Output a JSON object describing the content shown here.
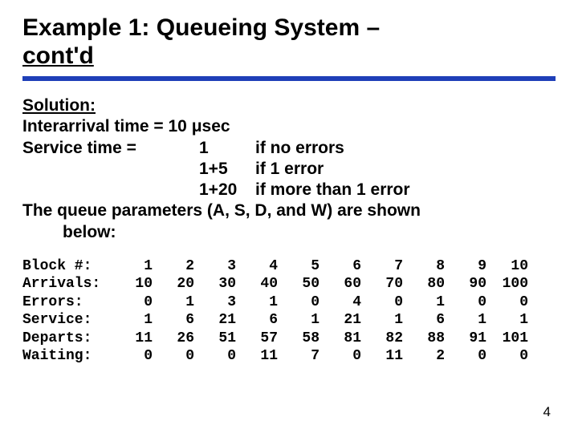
{
  "title_line1": "Example 1: Queueing System –",
  "title_line2": "cont'd",
  "solution_label": "Solution:",
  "interarrival_line": "Interarrival time = 10 μsec",
  "service_label": "Service time =",
  "service_rows": [
    {
      "value": "1",
      "cond": "if no errors"
    },
    {
      "value": "1+5",
      "cond": "if 1 error"
    },
    {
      "value": "1+20",
      "cond": "if more than 1 error"
    }
  ],
  "queue_params_line": "The queue parameters (A, S, D, and W) are shown",
  "queue_params_below": "below:",
  "table_row_labels": {
    "block": "Block #:",
    "arrivals": "Arrivals:",
    "errors": "Errors:",
    "service": "Service:",
    "departs": "Departs:",
    "waiting": "Waiting:"
  },
  "chart_data": {
    "type": "table",
    "title": "Queue parameters by block",
    "columns": [
      "Block #",
      "Arrivals",
      "Errors",
      "Service",
      "Departs",
      "Waiting"
    ],
    "block": [
      1,
      2,
      3,
      4,
      5,
      6,
      7,
      8,
      9,
      10
    ],
    "arrivals": [
      10,
      20,
      30,
      40,
      50,
      60,
      70,
      80,
      90,
      100
    ],
    "errors": [
      0,
      1,
      3,
      1,
      0,
      4,
      0,
      1,
      0,
      0
    ],
    "service": [
      1,
      6,
      21,
      6,
      1,
      21,
      1,
      6,
      1,
      1
    ],
    "departs": [
      11,
      26,
      51,
      57,
      58,
      81,
      82,
      88,
      91,
      101
    ],
    "waiting": [
      0,
      0,
      0,
      11,
      7,
      0,
      11,
      2,
      0,
      0
    ]
  },
  "page_number": "4"
}
